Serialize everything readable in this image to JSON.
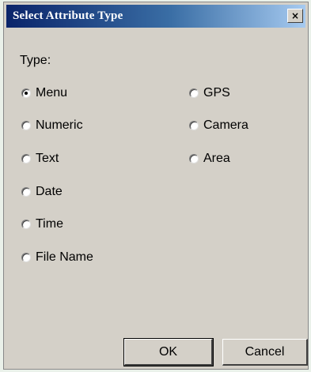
{
  "window": {
    "title": "Select Attribute Type",
    "close_glyph": "×"
  },
  "form": {
    "type_label": "Type:",
    "selected": "Menu",
    "options_left": [
      "Menu",
      "Numeric",
      "Text",
      "Date",
      "Time",
      "File Name"
    ],
    "options_right": [
      "GPS",
      "Camera",
      "Area"
    ]
  },
  "buttons": {
    "ok_label": "OK",
    "cancel_label": "Cancel"
  },
  "colors": {
    "titlebar_start": "#0a246a",
    "titlebar_end": "#a6caf0",
    "dialog_face": "#d4d0c8"
  }
}
